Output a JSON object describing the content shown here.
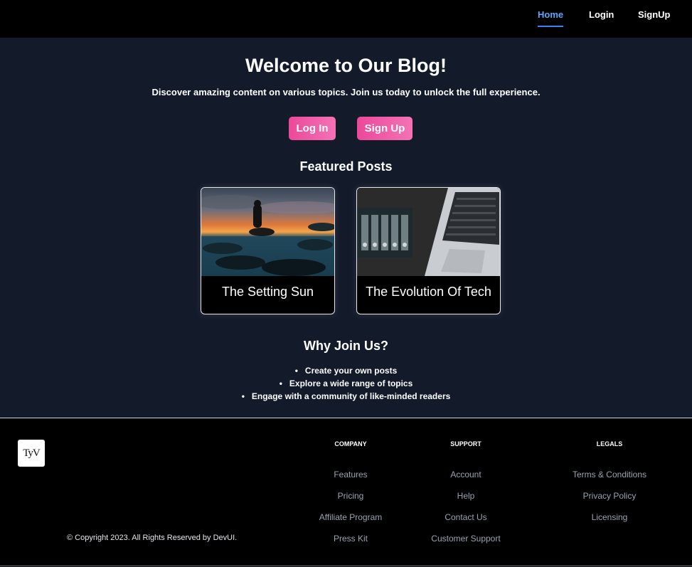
{
  "nav": {
    "home": "Home",
    "login": "Login",
    "signup": "SignUp"
  },
  "hero": {
    "title": "Welcome to Our Blog!",
    "subtitle": "Discover amazing content on various topics. Join us today to unlock the full experience.",
    "login_button": "Log In",
    "signup_button": "Sign Up"
  },
  "featured": {
    "title": "Featured Posts",
    "posts": [
      {
        "title": "The Setting Sun"
      },
      {
        "title": "The Evolution Of Tech"
      }
    ]
  },
  "why": {
    "title": "Why Join Us?",
    "items": [
      "Create your own posts",
      "Explore a wide range of topics",
      "Engage with a community of like-minded readers"
    ]
  },
  "footer": {
    "logo_text": "TyV",
    "copyright": "© Copyright 2023. All Rights Reserved by DevUI.",
    "company": {
      "heading": "COMPANY",
      "links": [
        "Features",
        "Pricing",
        "Affiliate Program",
        "Press Kit"
      ]
    },
    "support": {
      "heading": "SUPPORT",
      "links": [
        "Account",
        "Help",
        "Contact Us",
        "Customer Support"
      ]
    },
    "legals": {
      "heading": "LEGALS",
      "links": [
        "Terms & Conditions",
        "Privacy Policy",
        "Licensing"
      ]
    }
  },
  "colors": {
    "accent": "#3b82f6",
    "button_gradient_start": "#ec4899",
    "button_gradient_end": "#f472b6",
    "main_bg": "#131a2a"
  }
}
